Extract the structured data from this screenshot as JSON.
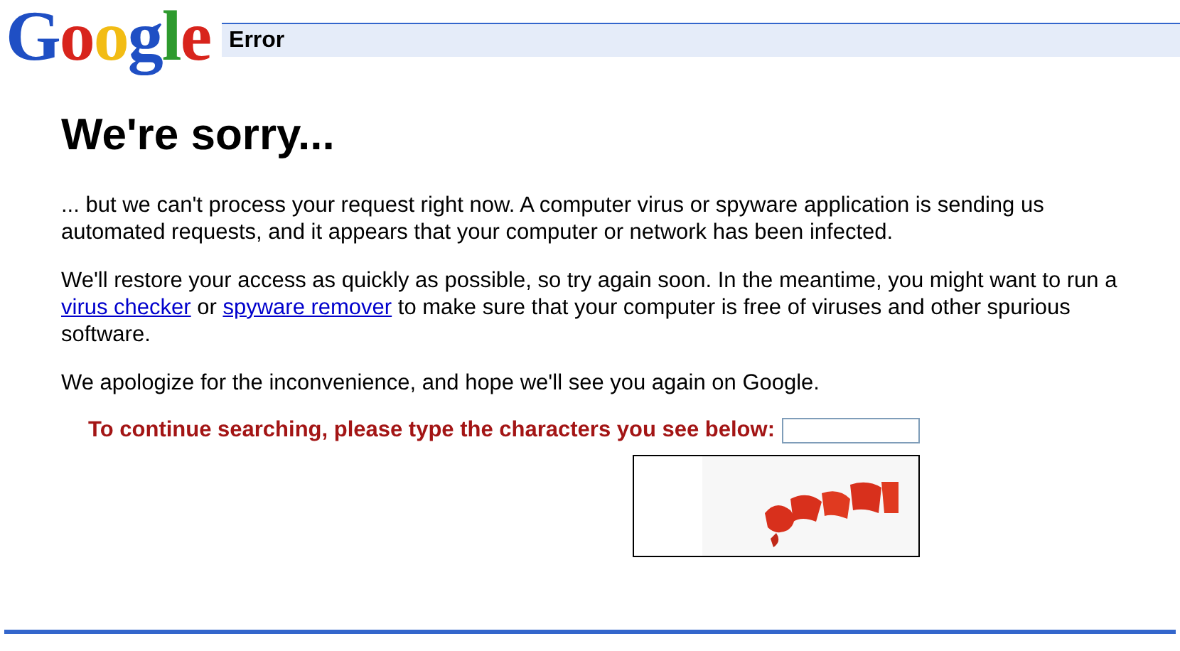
{
  "logo": "Google",
  "header": {
    "title": "Error"
  },
  "heading": "We're sorry...",
  "paragraphs": [
    [
      {
        "kind": "text",
        "text": "... but we can't process your request right now. A computer virus or spyware application is sending us automated requests, and it appears that your computer or network has been infected."
      }
    ],
    [
      {
        "kind": "text",
        "text": "We'll restore your access as quickly as possible, so try again soon. In the meantime, you might want to run a "
      },
      {
        "kind": "link",
        "text": "virus checker"
      },
      {
        "kind": "text",
        "text": " or "
      },
      {
        "kind": "link",
        "text": "spyware remover"
      },
      {
        "kind": "text",
        "text": " to make sure that your computer is free of viruses and other spurious software."
      }
    ],
    [
      {
        "kind": "text",
        "text": "We apologize for the inconvenience, and hope we'll see you again on Google."
      }
    ]
  ],
  "captcha": {
    "prompt": "To continue searching, please type the characters you see below:"
  }
}
